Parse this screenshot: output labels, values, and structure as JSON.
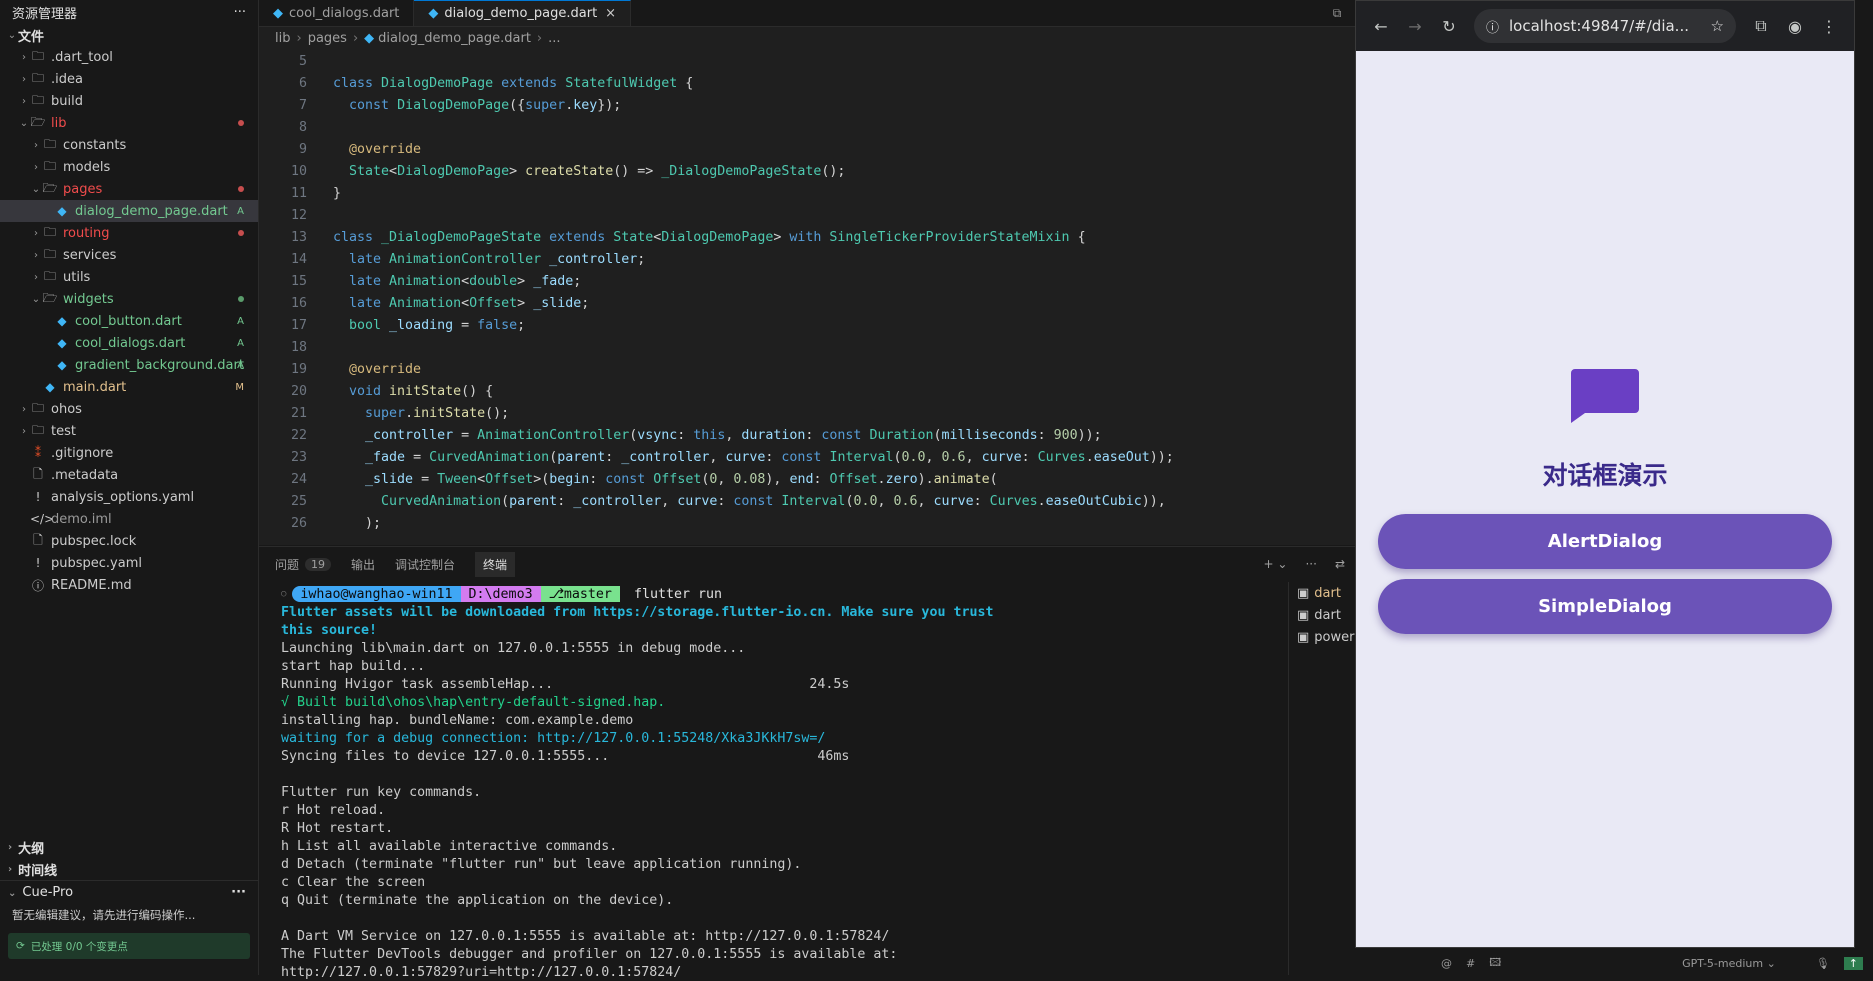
{
  "sidebar": {
    "title": "资源管理器",
    "more": "···",
    "root": "文件",
    "items": [
      {
        "label": ".dart_tool",
        "depth": 1,
        "chev": "›",
        "icon": "🗀",
        "color": "#cccccc",
        "badge": ""
      },
      {
        "label": ".idea",
        "depth": 1,
        "chev": "›",
        "icon": "🗀",
        "color": "#cccccc",
        "badge": ""
      },
      {
        "label": "build",
        "depth": 1,
        "chev": "›",
        "icon": "🗀",
        "color": "#cccccc",
        "badge": ""
      },
      {
        "label": "lib",
        "depth": 1,
        "chev": "⌄",
        "icon": "🗁",
        "color": "#f14c4c",
        "badge": "dot-red"
      },
      {
        "label": "constants",
        "depth": 2,
        "chev": "›",
        "icon": "🗀",
        "color": "#cccccc",
        "badge": ""
      },
      {
        "label": "models",
        "depth": 2,
        "chev": "›",
        "icon": "🗀",
        "color": "#cccccc",
        "badge": ""
      },
      {
        "label": "pages",
        "depth": 2,
        "chev": "⌄",
        "icon": "🗁",
        "color": "#f14c4c",
        "badge": "dot-red"
      },
      {
        "label": "dialog_demo_page.dart",
        "depth": 3,
        "chev": "",
        "icon": "◆",
        "color": "#73c991",
        "badge": "A",
        "active": true
      },
      {
        "label": "routing",
        "depth": 2,
        "chev": "›",
        "icon": "🗀",
        "color": "#f14c4c",
        "badge": "dot-red"
      },
      {
        "label": "services",
        "depth": 2,
        "chev": "›",
        "icon": "🗀",
        "color": "#cccccc",
        "badge": ""
      },
      {
        "label": "utils",
        "depth": 2,
        "chev": "›",
        "icon": "🗀",
        "color": "#cccccc",
        "badge": ""
      },
      {
        "label": "widgets",
        "depth": 2,
        "chev": "⌄",
        "icon": "🗁",
        "color": "#73c991",
        "badge": "dot-green"
      },
      {
        "label": "cool_button.dart",
        "depth": 3,
        "chev": "",
        "icon": "◆",
        "color": "#73c991",
        "badge": "A"
      },
      {
        "label": "cool_dialogs.dart",
        "depth": 3,
        "chev": "",
        "icon": "◆",
        "color": "#73c991",
        "badge": "A"
      },
      {
        "label": "gradient_background.dart",
        "depth": 3,
        "chev": "",
        "icon": "◆",
        "color": "#73c991",
        "badge": "A"
      },
      {
        "label": "main.dart",
        "depth": 2,
        "chev": "",
        "icon": "◆",
        "color": "#e2c08d",
        "badge": "M"
      },
      {
        "label": "ohos",
        "depth": 1,
        "chev": "›",
        "icon": "🗀",
        "color": "#cccccc",
        "badge": ""
      },
      {
        "label": "test",
        "depth": 1,
        "chev": "›",
        "icon": "🗀",
        "color": "#cccccc",
        "badge": ""
      },
      {
        "label": ".gitignore",
        "depth": 1,
        "chev": "",
        "icon": "⁑",
        "color": "#cccccc",
        "badge": ""
      },
      {
        "label": ".metadata",
        "depth": 1,
        "chev": "",
        "icon": "🗋",
        "color": "#cccccc",
        "badge": ""
      },
      {
        "label": "analysis_options.yaml",
        "depth": 1,
        "chev": "",
        "icon": "!",
        "color": "#cccccc",
        "badge": ""
      },
      {
        "label": "demo.iml",
        "depth": 1,
        "chev": "",
        "icon": "</>",
        "color": "#9a9a9a",
        "badge": ""
      },
      {
        "label": "pubspec.lock",
        "depth": 1,
        "chev": "",
        "icon": "🗋",
        "color": "#cccccc",
        "badge": ""
      },
      {
        "label": "pubspec.yaml",
        "depth": 1,
        "chev": "",
        "icon": "!",
        "color": "#cccccc",
        "badge": ""
      },
      {
        "label": "README.md",
        "depth": 1,
        "chev": "",
        "icon": "ⓘ",
        "color": "#cccccc",
        "badge": ""
      }
    ],
    "outline": "大纲",
    "timeline": "时间线",
    "cue_title": "Cue-Pro",
    "cue_message": "暂无编辑建议，请先进行编码操作...",
    "cue_status": "已处理 0/0 个变更点"
  },
  "editor": {
    "tabs": [
      {
        "label": "cool_dialogs.dart",
        "active": false
      },
      {
        "label": "dialog_demo_page.dart",
        "active": true
      }
    ],
    "tab_close": "×",
    "breadcrumb": [
      "lib",
      "pages",
      "dialog_demo_page.dart",
      "..."
    ],
    "lines": [
      {
        "n": "5",
        "t": []
      },
      {
        "n": "6",
        "t": [
          [
            "kb",
            "class "
          ],
          [
            "ty",
            "DialogDemoPage "
          ],
          [
            "kb",
            "extends "
          ],
          [
            "ty",
            "StatefulWidget "
          ],
          [
            "pl",
            "{"
          ]
        ]
      },
      {
        "n": "7",
        "t": [
          [
            "pl",
            "  "
          ],
          [
            "kb",
            "const "
          ],
          [
            "ty",
            "DialogDemoPage"
          ],
          [
            "pl",
            "({"
          ],
          [
            "kb",
            "super"
          ],
          [
            "pl",
            "."
          ],
          [
            "va",
            "key"
          ],
          [
            "pl",
            "});"
          ]
        ]
      },
      {
        "n": "8",
        "t": []
      },
      {
        "n": "9",
        "t": [
          [
            "pl",
            "  "
          ],
          [
            "an",
            "@override"
          ]
        ]
      },
      {
        "n": "10",
        "t": [
          [
            "pl",
            "  "
          ],
          [
            "ty",
            "State"
          ],
          [
            "pl",
            "<"
          ],
          [
            "ty",
            "DialogDemoPage"
          ],
          [
            "pl",
            "> "
          ],
          [
            "fn",
            "createState"
          ],
          [
            "pl",
            "() => "
          ],
          [
            "ty",
            "_DialogDemoPageState"
          ],
          [
            "pl",
            "();"
          ]
        ]
      },
      {
        "n": "11",
        "t": [
          [
            "pl",
            "}"
          ]
        ]
      },
      {
        "n": "12",
        "t": []
      },
      {
        "n": "13",
        "t": [
          [
            "kb",
            "class "
          ],
          [
            "ty",
            "_DialogDemoPageState "
          ],
          [
            "kb",
            "extends "
          ],
          [
            "ty",
            "State"
          ],
          [
            "pl",
            "<"
          ],
          [
            "ty",
            "DialogDemoPage"
          ],
          [
            "pl",
            "> "
          ],
          [
            "kb",
            "with "
          ],
          [
            "ty",
            "SingleTickerProviderStateMixin "
          ],
          [
            "pl",
            "{"
          ]
        ]
      },
      {
        "n": "14",
        "t": [
          [
            "pl",
            "  "
          ],
          [
            "kb",
            "late "
          ],
          [
            "ty",
            "AnimationController "
          ],
          [
            "va",
            "_controller"
          ],
          [
            "pl",
            ";"
          ]
        ]
      },
      {
        "n": "15",
        "t": [
          [
            "pl",
            "  "
          ],
          [
            "kb",
            "late "
          ],
          [
            "ty",
            "Animation"
          ],
          [
            "pl",
            "<"
          ],
          [
            "ty",
            "double"
          ],
          [
            "pl",
            "> "
          ],
          [
            "va",
            "_fade"
          ],
          [
            "pl",
            ";"
          ]
        ]
      },
      {
        "n": "16",
        "t": [
          [
            "pl",
            "  "
          ],
          [
            "kb",
            "late "
          ],
          [
            "ty",
            "Animation"
          ],
          [
            "pl",
            "<"
          ],
          [
            "ty",
            "Offset"
          ],
          [
            "pl",
            "> "
          ],
          [
            "va",
            "_slide"
          ],
          [
            "pl",
            ";"
          ]
        ]
      },
      {
        "n": "17",
        "t": [
          [
            "pl",
            "  "
          ],
          [
            "ty",
            "bool "
          ],
          [
            "va",
            "_loading "
          ],
          [
            "pl",
            "= "
          ],
          [
            "kb",
            "false"
          ],
          [
            "pl",
            ";"
          ]
        ]
      },
      {
        "n": "18",
        "t": []
      },
      {
        "n": "19",
        "t": [
          [
            "pl",
            "  "
          ],
          [
            "an",
            "@override"
          ]
        ]
      },
      {
        "n": "20",
        "t": [
          [
            "pl",
            "  "
          ],
          [
            "kb",
            "void "
          ],
          [
            "fn",
            "initState"
          ],
          [
            "pl",
            "() {"
          ]
        ]
      },
      {
        "n": "21",
        "t": [
          [
            "pl",
            "    "
          ],
          [
            "kb",
            "super"
          ],
          [
            "pl",
            "."
          ],
          [
            "fn",
            "initState"
          ],
          [
            "pl",
            "();"
          ]
        ]
      },
      {
        "n": "22",
        "t": [
          [
            "pl",
            "    "
          ],
          [
            "va",
            "_controller "
          ],
          [
            "pl",
            "= "
          ],
          [
            "ty",
            "AnimationController"
          ],
          [
            "pl",
            "("
          ],
          [
            "va",
            "vsync"
          ],
          [
            "pl",
            ": "
          ],
          [
            "kb",
            "this"
          ],
          [
            "pl",
            ", "
          ],
          [
            "va",
            "duration"
          ],
          [
            "pl",
            ": "
          ],
          [
            "kb",
            "const "
          ],
          [
            "ty",
            "Duration"
          ],
          [
            "pl",
            "("
          ],
          [
            "va",
            "milliseconds"
          ],
          [
            "pl",
            ": "
          ],
          [
            "nu",
            "900"
          ],
          [
            "pl",
            "));"
          ]
        ]
      },
      {
        "n": "23",
        "t": [
          [
            "pl",
            "    "
          ],
          [
            "va",
            "_fade "
          ],
          [
            "pl",
            "= "
          ],
          [
            "ty",
            "CurvedAnimation"
          ],
          [
            "pl",
            "("
          ],
          [
            "va",
            "parent"
          ],
          [
            "pl",
            ": "
          ],
          [
            "va",
            "_controller"
          ],
          [
            "pl",
            ", "
          ],
          [
            "va",
            "curve"
          ],
          [
            "pl",
            ": "
          ],
          [
            "kb",
            "const "
          ],
          [
            "ty",
            "Interval"
          ],
          [
            "pl",
            "("
          ],
          [
            "nu",
            "0.0"
          ],
          [
            "pl",
            ", "
          ],
          [
            "nu",
            "0.6"
          ],
          [
            "pl",
            ", "
          ],
          [
            "va",
            "curve"
          ],
          [
            "pl",
            ": "
          ],
          [
            "ty",
            "Curves"
          ],
          [
            "pl",
            "."
          ],
          [
            "va",
            "easeOut"
          ],
          [
            "pl",
            "));"
          ]
        ]
      },
      {
        "n": "24",
        "t": [
          [
            "pl",
            "    "
          ],
          [
            "va",
            "_slide "
          ],
          [
            "pl",
            "= "
          ],
          [
            "ty",
            "Tween"
          ],
          [
            "pl",
            "<"
          ],
          [
            "ty",
            "Offset"
          ],
          [
            "pl",
            ">("
          ],
          [
            "va",
            "begin"
          ],
          [
            "pl",
            ": "
          ],
          [
            "kb",
            "const "
          ],
          [
            "ty",
            "Offset"
          ],
          [
            "pl",
            "("
          ],
          [
            "nu",
            "0"
          ],
          [
            "pl",
            ", "
          ],
          [
            "nu",
            "0.08"
          ],
          [
            "pl",
            "), "
          ],
          [
            "va",
            "end"
          ],
          [
            "pl",
            ": "
          ],
          [
            "ty",
            "Offset"
          ],
          [
            "pl",
            "."
          ],
          [
            "va",
            "zero"
          ],
          [
            "pl",
            ")."
          ],
          [
            "fn",
            "animate"
          ],
          [
            "pl",
            "("
          ]
        ]
      },
      {
        "n": "25",
        "t": [
          [
            "pl",
            "      "
          ],
          [
            "ty",
            "CurvedAnimation"
          ],
          [
            "pl",
            "("
          ],
          [
            "va",
            "parent"
          ],
          [
            "pl",
            ": "
          ],
          [
            "va",
            "_controller"
          ],
          [
            "pl",
            ", "
          ],
          [
            "va",
            "curve"
          ],
          [
            "pl",
            ": "
          ],
          [
            "kb",
            "const "
          ],
          [
            "ty",
            "Interval"
          ],
          [
            "pl",
            "("
          ],
          [
            "nu",
            "0.0"
          ],
          [
            "pl",
            ", "
          ],
          [
            "nu",
            "0.6"
          ],
          [
            "pl",
            ", "
          ],
          [
            "va",
            "curve"
          ],
          [
            "pl",
            ": "
          ],
          [
            "ty",
            "Curves"
          ],
          [
            "pl",
            "."
          ],
          [
            "va",
            "easeOutCubic"
          ],
          [
            "pl",
            ")),"
          ]
        ]
      },
      {
        "n": "26",
        "t": [
          [
            "pl",
            "    );"
          ]
        ]
      }
    ]
  },
  "panel": {
    "tabs": [
      {
        "label": "问题",
        "count": "19"
      },
      {
        "label": "输出",
        "count": ""
      },
      {
        "label": "调试控制台",
        "count": ""
      },
      {
        "label": "终端",
        "count": "",
        "active": true
      }
    ],
    "actions": [
      "+ ⌄",
      "···",
      "⇄",
      "⌃"
    ],
    "prompt": {
      "user": "iwhao@wanghao-win11",
      "dir": "D:\\demo3",
      "branch": "master",
      "cmd": "flutter run"
    },
    "output": [
      {
        "text": "Flutter assets will be downloaded from https://storage.flutter-io.cn. Make sure you trust",
        "color": "#29b8db",
        "bold": true
      },
      {
        "text": "this source!",
        "color": "#29b8db",
        "bold": true
      },
      {
        "text": "Launching lib\\main.dart on 127.0.0.1:5555 in debug mode...",
        "color": "#cccccc"
      },
      {
        "text": "start hap build...",
        "color": "#cccccc"
      },
      {
        "text": "Running Hvigor task assembleHap...                                24.5s",
        "color": "#cccccc"
      },
      {
        "text": "√ Built build\\ohos\\hap\\entry-default-signed.hap.",
        "color": "#23d18b"
      },
      {
        "text": "installing hap. bundleName: com.example.demo",
        "color": "#cccccc"
      },
      {
        "text": "waiting for a debug connection: http://127.0.0.1:55248/Xka3JKkH7sw=/",
        "color": "#29b8db"
      },
      {
        "text": "Syncing files to device 127.0.0.1:5555...                          46ms",
        "color": "#cccccc"
      },
      {
        "text": "",
        "color": "#cccccc"
      },
      {
        "text": "Flutter run key commands.",
        "color": "#cccccc"
      },
      {
        "text": "r Hot reload.",
        "color": "#cccccc"
      },
      {
        "text": "R Hot restart.",
        "color": "#cccccc"
      },
      {
        "text": "h List all available interactive commands.",
        "color": "#cccccc"
      },
      {
        "text": "d Detach (terminate \"flutter run\" but leave application running).",
        "color": "#cccccc"
      },
      {
        "text": "c Clear the screen",
        "color": "#cccccc"
      },
      {
        "text": "q Quit (terminate the application on the device).",
        "color": "#cccccc"
      },
      {
        "text": "",
        "color": "#cccccc"
      },
      {
        "text": "A Dart VM Service on 127.0.0.1:5555 is available at: http://127.0.0.1:57824/",
        "color": "#cccccc"
      },
      {
        "text": "The Flutter DevTools debugger and profiler on 127.0.0.1:5555 is available at:",
        "color": "#cccccc"
      },
      {
        "text": "http://127.0.0.1:57829?uri=http://127.0.0.1:57824/",
        "color": "#cccccc"
      }
    ],
    "terminals": [
      {
        "label": "dart",
        "color": "#e2c08d"
      },
      {
        "label": "dart",
        "color": "#cccccc"
      },
      {
        "label": "powershell",
        "color": "#cccccc"
      }
    ]
  },
  "browser": {
    "url": "localhost:49847/#/dia...",
    "app_title": "对话框演示",
    "buttons": [
      "AlertDialog",
      "SimpleDialog"
    ],
    "accent": "#6b53b8",
    "icon_color": "#6a3fc4"
  },
  "chat_bar": {
    "icons": [
      "@",
      "#",
      "🖾"
    ],
    "model": "GPT-5-medium ⌄"
  }
}
